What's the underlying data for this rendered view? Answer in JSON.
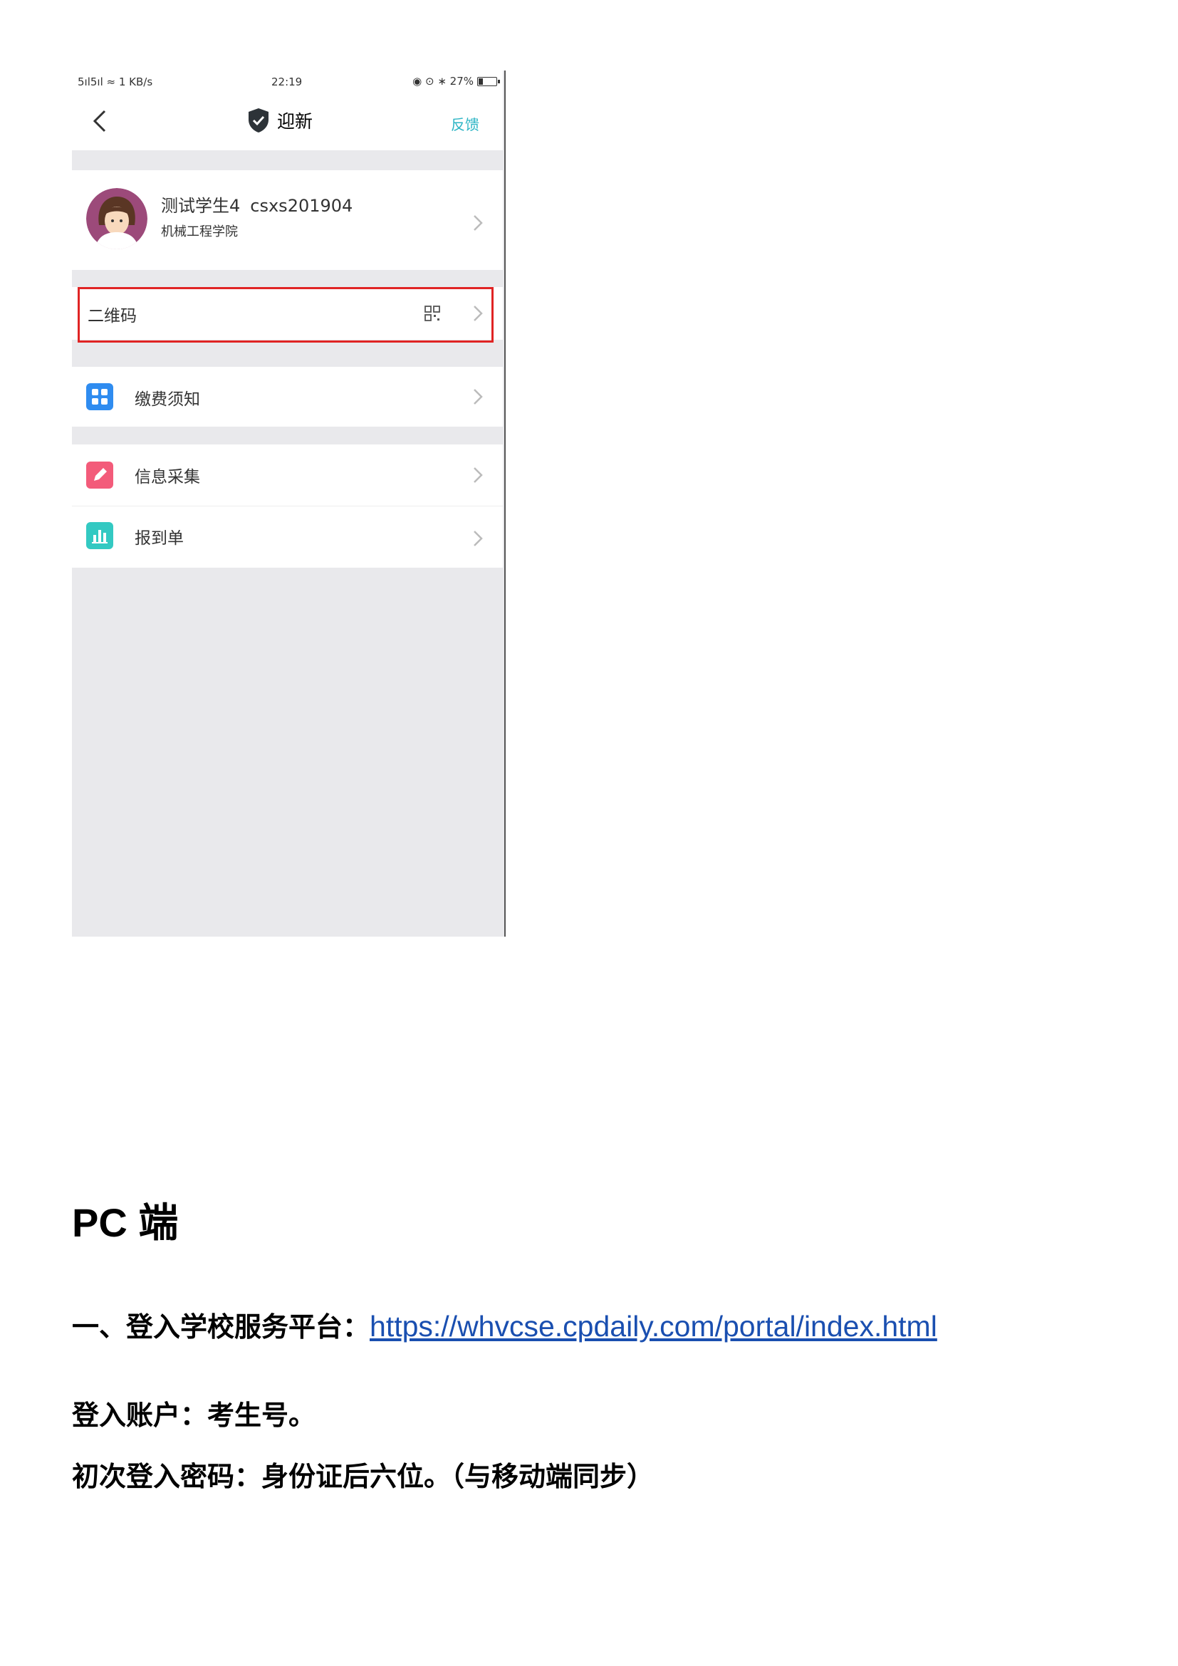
{
  "phone": {
    "status": {
      "signal": "5ıl5ıl ≈ 1 KB/s",
      "time": "22:19",
      "right": "◉ ⊙ ∗ 27%",
      "battery_level": 0.27
    },
    "nav": {
      "title": "迎新",
      "feedback": "反馈"
    },
    "profile": {
      "name": "测试学生4",
      "id": "csxs201904",
      "department": "机械工程学院"
    },
    "items": {
      "qr": "二维码",
      "pay": "缴费须知",
      "info": "信息采集",
      "report": "报到单"
    },
    "colors": {
      "pay_icon": "#2f8cf0",
      "info_icon": "#f35b7a",
      "report_icon": "#33c9c2",
      "highlight": "#e02424",
      "accent": "#2bb4c4"
    }
  },
  "doc": {
    "heading": "PC 端",
    "line1_prefix": "一、登入学校服务平台：",
    "line1_link": "https://whvcse.cpdaily.com/portal/index.html",
    "line2": "登入账户：考生号。",
    "line3": "初次登入密码：身份证后六位。（与移动端同步）"
  }
}
